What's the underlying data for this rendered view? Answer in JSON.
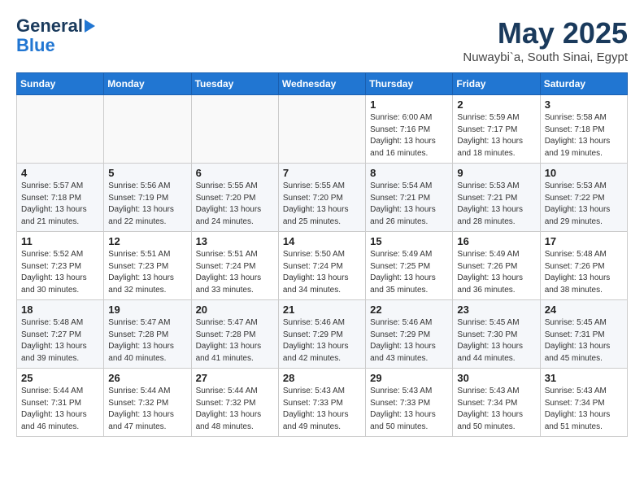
{
  "header": {
    "logo_line1": "General",
    "logo_line2": "Blue",
    "month": "May 2025",
    "location": "Nuwaybi`a, South Sinai, Egypt"
  },
  "weekdays": [
    "Sunday",
    "Monday",
    "Tuesday",
    "Wednesday",
    "Thursday",
    "Friday",
    "Saturday"
  ],
  "weeks": [
    [
      {
        "day": "",
        "info": ""
      },
      {
        "day": "",
        "info": ""
      },
      {
        "day": "",
        "info": ""
      },
      {
        "day": "",
        "info": ""
      },
      {
        "day": "1",
        "info": "Sunrise: 6:00 AM\nSunset: 7:16 PM\nDaylight: 13 hours\nand 16 minutes."
      },
      {
        "day": "2",
        "info": "Sunrise: 5:59 AM\nSunset: 7:17 PM\nDaylight: 13 hours\nand 18 minutes."
      },
      {
        "day": "3",
        "info": "Sunrise: 5:58 AM\nSunset: 7:18 PM\nDaylight: 13 hours\nand 19 minutes."
      }
    ],
    [
      {
        "day": "4",
        "info": "Sunrise: 5:57 AM\nSunset: 7:18 PM\nDaylight: 13 hours\nand 21 minutes."
      },
      {
        "day": "5",
        "info": "Sunrise: 5:56 AM\nSunset: 7:19 PM\nDaylight: 13 hours\nand 22 minutes."
      },
      {
        "day": "6",
        "info": "Sunrise: 5:55 AM\nSunset: 7:20 PM\nDaylight: 13 hours\nand 24 minutes."
      },
      {
        "day": "7",
        "info": "Sunrise: 5:55 AM\nSunset: 7:20 PM\nDaylight: 13 hours\nand 25 minutes."
      },
      {
        "day": "8",
        "info": "Sunrise: 5:54 AM\nSunset: 7:21 PM\nDaylight: 13 hours\nand 26 minutes."
      },
      {
        "day": "9",
        "info": "Sunrise: 5:53 AM\nSunset: 7:21 PM\nDaylight: 13 hours\nand 28 minutes."
      },
      {
        "day": "10",
        "info": "Sunrise: 5:53 AM\nSunset: 7:22 PM\nDaylight: 13 hours\nand 29 minutes."
      }
    ],
    [
      {
        "day": "11",
        "info": "Sunrise: 5:52 AM\nSunset: 7:23 PM\nDaylight: 13 hours\nand 30 minutes."
      },
      {
        "day": "12",
        "info": "Sunrise: 5:51 AM\nSunset: 7:23 PM\nDaylight: 13 hours\nand 32 minutes."
      },
      {
        "day": "13",
        "info": "Sunrise: 5:51 AM\nSunset: 7:24 PM\nDaylight: 13 hours\nand 33 minutes."
      },
      {
        "day": "14",
        "info": "Sunrise: 5:50 AM\nSunset: 7:24 PM\nDaylight: 13 hours\nand 34 minutes."
      },
      {
        "day": "15",
        "info": "Sunrise: 5:49 AM\nSunset: 7:25 PM\nDaylight: 13 hours\nand 35 minutes."
      },
      {
        "day": "16",
        "info": "Sunrise: 5:49 AM\nSunset: 7:26 PM\nDaylight: 13 hours\nand 36 minutes."
      },
      {
        "day": "17",
        "info": "Sunrise: 5:48 AM\nSunset: 7:26 PM\nDaylight: 13 hours\nand 38 minutes."
      }
    ],
    [
      {
        "day": "18",
        "info": "Sunrise: 5:48 AM\nSunset: 7:27 PM\nDaylight: 13 hours\nand 39 minutes."
      },
      {
        "day": "19",
        "info": "Sunrise: 5:47 AM\nSunset: 7:28 PM\nDaylight: 13 hours\nand 40 minutes."
      },
      {
        "day": "20",
        "info": "Sunrise: 5:47 AM\nSunset: 7:28 PM\nDaylight: 13 hours\nand 41 minutes."
      },
      {
        "day": "21",
        "info": "Sunrise: 5:46 AM\nSunset: 7:29 PM\nDaylight: 13 hours\nand 42 minutes."
      },
      {
        "day": "22",
        "info": "Sunrise: 5:46 AM\nSunset: 7:29 PM\nDaylight: 13 hours\nand 43 minutes."
      },
      {
        "day": "23",
        "info": "Sunrise: 5:45 AM\nSunset: 7:30 PM\nDaylight: 13 hours\nand 44 minutes."
      },
      {
        "day": "24",
        "info": "Sunrise: 5:45 AM\nSunset: 7:31 PM\nDaylight: 13 hours\nand 45 minutes."
      }
    ],
    [
      {
        "day": "25",
        "info": "Sunrise: 5:44 AM\nSunset: 7:31 PM\nDaylight: 13 hours\nand 46 minutes."
      },
      {
        "day": "26",
        "info": "Sunrise: 5:44 AM\nSunset: 7:32 PM\nDaylight: 13 hours\nand 47 minutes."
      },
      {
        "day": "27",
        "info": "Sunrise: 5:44 AM\nSunset: 7:32 PM\nDaylight: 13 hours\nand 48 minutes."
      },
      {
        "day": "28",
        "info": "Sunrise: 5:43 AM\nSunset: 7:33 PM\nDaylight: 13 hours\nand 49 minutes."
      },
      {
        "day": "29",
        "info": "Sunrise: 5:43 AM\nSunset: 7:33 PM\nDaylight: 13 hours\nand 50 minutes."
      },
      {
        "day": "30",
        "info": "Sunrise: 5:43 AM\nSunset: 7:34 PM\nDaylight: 13 hours\nand 50 minutes."
      },
      {
        "day": "31",
        "info": "Sunrise: 5:43 AM\nSunset: 7:34 PM\nDaylight: 13 hours\nand 51 minutes."
      }
    ]
  ]
}
